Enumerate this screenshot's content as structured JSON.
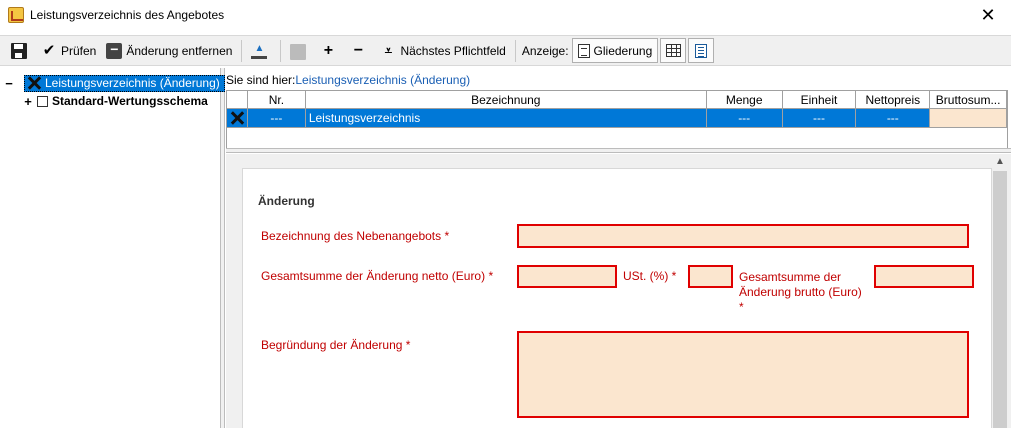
{
  "window": {
    "title": "Leistungsverzeichnis des Angebotes",
    "close_glyph": "✕"
  },
  "toolbar": {
    "check_label": "Prüfen",
    "remove_change_label": "Änderung entfernen",
    "next_required_label": "Nächstes Pflichtfeld",
    "view_label": "Anzeige:",
    "outline_label": "Gliederung",
    "plus_glyph": "+",
    "minus_glyph": "−",
    "check_glyph": "✔",
    "next_glyph": "⩡"
  },
  "tree": {
    "items": [
      {
        "expander": "−",
        "label": "Leistungsverzeichnis (Änderung)",
        "selected": true
      },
      {
        "expander": "+",
        "label": "Standard-Wertungsschema",
        "selected": false
      }
    ]
  },
  "breadcrumb": {
    "prefix": "Sie sind hier:",
    "link": "Leistungsverzeichnis (Änderung)"
  },
  "grid": {
    "columns": [
      "Nr.",
      "Bezeichnung",
      "Menge",
      "Einheit",
      "Nettopreis",
      "Bruttosum..."
    ],
    "rows": [
      {
        "nr": "---",
        "bezeichnung": "Leistungsverzeichnis",
        "menge": "---",
        "einheit": "---",
        "nettopreis": "---",
        "brutto": ""
      }
    ]
  },
  "form": {
    "section_title": "Änderung",
    "label_bezeichnung": "Bezeichnung des Nebenangebots *",
    "label_netto": "Gesamtsumme der Änderung netto (Euro) *",
    "label_ust": "USt. (%) *",
    "label_brutto_line1": "Gesamtsumme der",
    "label_brutto_line2": "Änderung brutto (Euro)",
    "label_brutto_line3": "*",
    "label_begruendung": "Begründung der Änderung *",
    "value_bezeichnung": "",
    "value_netto": "",
    "value_ust": "",
    "value_brutto": "",
    "value_begruendung": ""
  },
  "colors": {
    "selection": "#0078d7",
    "required_label": "#c00000",
    "required_border": "#e00000",
    "input_fill": "#fbe6cf",
    "link": "#1a5fb4"
  }
}
